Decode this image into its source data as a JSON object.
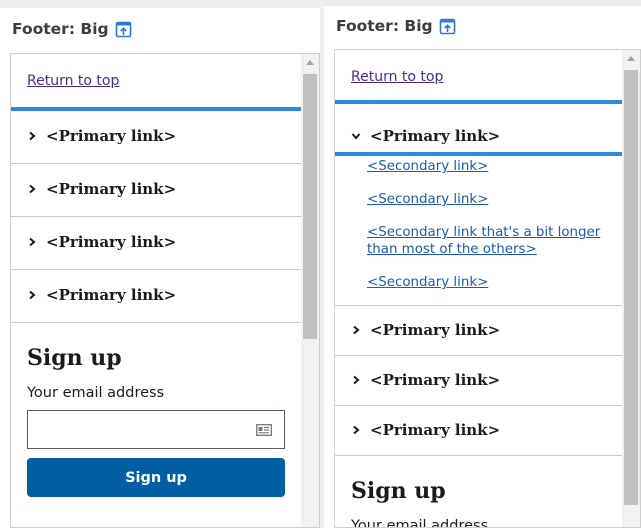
{
  "left": {
    "header_title": "Footer: Big",
    "return_link": "Return to top",
    "primary_links": [
      "<Primary link>",
      "<Primary link>",
      "<Primary link>",
      "<Primary link>"
    ],
    "signup": {
      "title": "Sign up",
      "email_label": "Your email address",
      "button_label": "Sign up"
    }
  },
  "right": {
    "header_title": "Footer: Big",
    "return_link": "Return to top",
    "expanded_link": "<Primary link>",
    "secondary_links": [
      "<Secondary link>",
      "<Secondary link>",
      "<Secondary link that's a bit longer than most of the others>",
      "<Secondary link>"
    ],
    "primary_links": [
      "<Primary link>",
      "<Primary link>",
      "<Primary link>"
    ],
    "signup": {
      "title": "Sign up",
      "email_label": "Your email address"
    }
  },
  "colors": {
    "link_visited": "#4c2c92",
    "link": "#1a5bb5",
    "accent_rule": "#2b8cde",
    "button": "#005ea2"
  }
}
